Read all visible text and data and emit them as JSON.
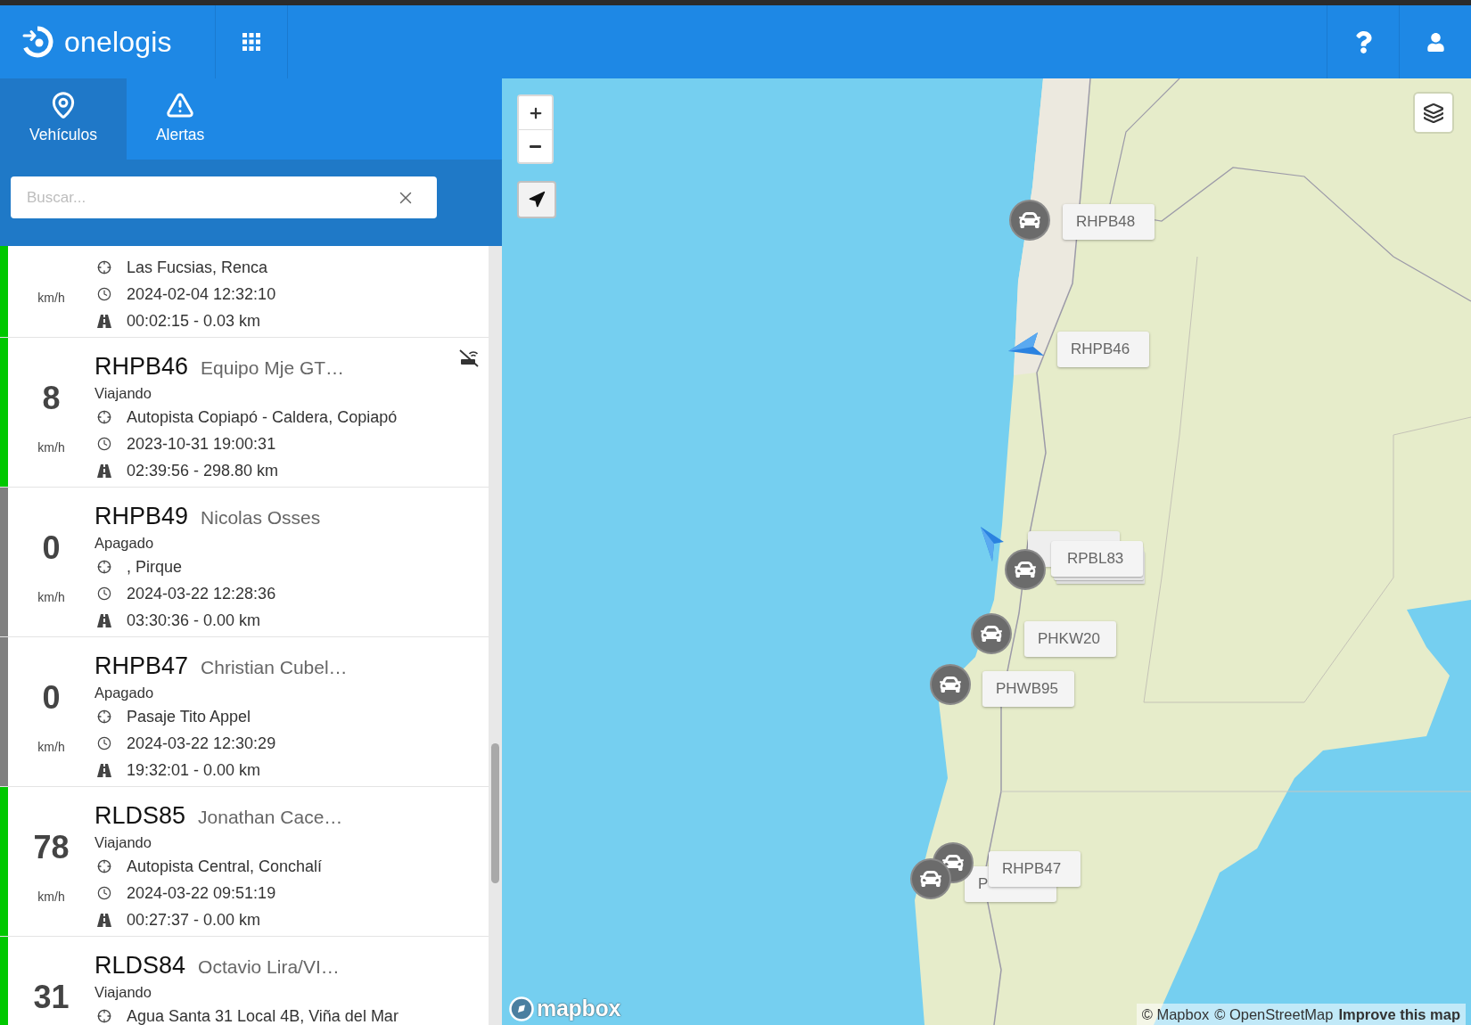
{
  "header": {
    "brand": "onelogis"
  },
  "tabs": [
    {
      "kind": "vehicles",
      "label": "Vehículos",
      "selected": true
    },
    {
      "kind": "alerts",
      "label": "Alertas",
      "selected": false
    }
  ],
  "search": {
    "placeholder": "Buscar..."
  },
  "rows": [
    {
      "color": "#00c800",
      "unit": "km/h",
      "signal_lost": false,
      "details": [
        {
          "kind": "location",
          "text": "Las Fucsias, Renca"
        },
        {
          "kind": "time",
          "text": "2024-02-04 12:32:10"
        },
        {
          "kind": "trip",
          "text": "00:02:15 - 0.03 km"
        }
      ]
    },
    {
      "color": "#00c800",
      "speed": "8",
      "unit": "km/h",
      "plate": "RHPB46",
      "name": "Equipo Mje GT…",
      "status": "Viajando",
      "signal_lost": true,
      "details": [
        {
          "kind": "location",
          "text": "Autopista Copiapó - Caldera, Copiapó"
        },
        {
          "kind": "time",
          "text": "2023-10-31 19:00:31"
        },
        {
          "kind": "trip",
          "text": "02:39:56 - 298.80 km"
        }
      ]
    },
    {
      "color": "#808080",
      "speed": "0",
      "unit": "km/h",
      "plate": "RHPB49",
      "name": "Nicolas Osses",
      "status": "Apagado",
      "signal_lost": false,
      "details": [
        {
          "kind": "location",
          "text": ", Pirque"
        },
        {
          "kind": "time",
          "text": "2024-03-22 12:28:36"
        },
        {
          "kind": "trip",
          "text": "03:30:36 - 0.00 km"
        }
      ]
    },
    {
      "color": "#808080",
      "speed": "0",
      "unit": "km/h",
      "plate": "RHPB47",
      "name": "Christian Cubel…",
      "status": "Apagado",
      "signal_lost": false,
      "details": [
        {
          "kind": "location",
          "text": "Pasaje Tito Appel"
        },
        {
          "kind": "time",
          "text": "2024-03-22 12:30:29"
        },
        {
          "kind": "trip",
          "text": "19:32:01 - 0.00 km"
        }
      ]
    },
    {
      "color": "#00c800",
      "speed": "78",
      "unit": "km/h",
      "plate": "RLDS85",
      "name": "Jonathan Cace…",
      "status": "Viajando",
      "signal_lost": false,
      "details": [
        {
          "kind": "location",
          "text": "Autopista Central, Conchalí"
        },
        {
          "kind": "time",
          "text": "2024-03-22 09:51:19"
        },
        {
          "kind": "trip",
          "text": "00:27:37 - 0.00 km"
        }
      ]
    },
    {
      "color": "#00c800",
      "speed": "31",
      "plate": "RLDS84",
      "name": "Octavio Lira/VI…",
      "status": "Viajando",
      "signal_lost": false,
      "details": [
        {
          "kind": "location",
          "text": "Agua Santa 31 Local 4B, Viña del Mar"
        }
      ]
    }
  ],
  "map": {
    "markers": [
      {
        "kind": "car",
        "label": "RHPB48"
      },
      {
        "kind": "arrow",
        "label": "RHPB46"
      },
      {
        "kind": "arrow"
      },
      {
        "kind": "car_stack",
        "label": "RPBL83"
      },
      {
        "kind": "car",
        "label": "PHKW20"
      },
      {
        "kind": "car",
        "label": "PHWB95"
      },
      {
        "kind": "car",
        "label": "P"
      },
      {
        "kind": "car",
        "label": "RHPB47"
      }
    ],
    "logo": "mapbox",
    "attribution": [
      {
        "kind": "credit",
        "text": "© Mapbox"
      },
      {
        "kind": "credit",
        "text": "© OpenStreetMap"
      },
      {
        "kind": "feedback",
        "text": "Improve this map"
      }
    ]
  }
}
